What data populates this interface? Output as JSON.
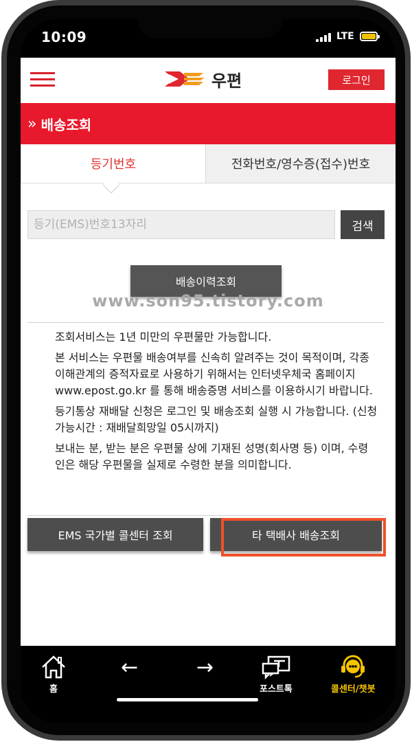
{
  "status": {
    "time": "10:09",
    "network": "LTE"
  },
  "header": {
    "logo_text": "우편",
    "login_label": "로그인"
  },
  "section": {
    "title": "배송조회"
  },
  "tabs": [
    {
      "label": "등기번호"
    },
    {
      "label": "전화번호/영수증(접수)번호"
    }
  ],
  "search": {
    "placeholder": "등기(EMS)번호13자리",
    "value": "",
    "button_label": "검색"
  },
  "history_button": {
    "label": "배송이력조회"
  },
  "watermark": "www.son95.tistory.com",
  "notices": [
    "조회서비스는 1년 미만의 우편물만 가능합니다.",
    "본 서비스는 우편물 배송여부를 신속히 알려주는 것이 목적이며, 각종 이해관계의 증적자료로 사용하기 위해서는 인터넷우체국 홈페이지 www.epost.go.kr 를 통해 배송증명 서비스를 이용하시기 바랍니다.",
    "등기통상 재배달 신청은 로그인 및 배송조회 실행 시 가능합니다. (신청가능시간 : 재배달희망일 05시까지)",
    "보내는 분, 받는 분은 우편물 상에 기재된 성명(회사명 등) 이며, 수령인은 해당 우편물을 실제로 수령한 분을 의미합니다."
  ],
  "buttons": {
    "ems": "EMS 국가별 콜센터 조회",
    "courier": "타 택배사 배송조회"
  },
  "nav": {
    "home": "홈",
    "back": "←",
    "forward": "→",
    "posttalk": "포스트톡",
    "callcenter": "콜센터/챗봇"
  },
  "colors": {
    "brand_red": "#e8192c",
    "highlight": "#f0502a",
    "nav_accent": "#f5c400"
  }
}
